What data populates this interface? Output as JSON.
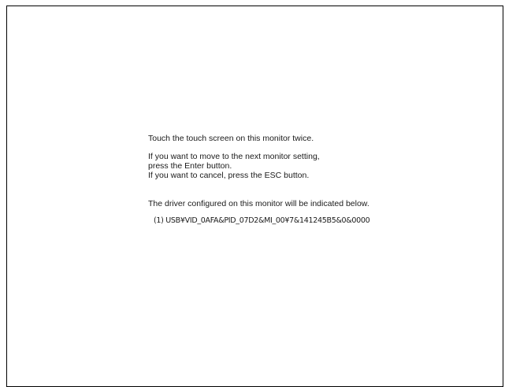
{
  "instructions": {
    "line1": "Touch the touch screen on this monitor twice.",
    "line2": "If you want to move to the next monitor setting,",
    "line3": "press the Enter button.",
    "line4": "If you want to cancel, press the ESC button."
  },
  "driver_section": {
    "heading": "The driver configured on this monitor will be indicated below.",
    "entries": [
      "(1) USB¥VID_0AFA&PID_07D2&MI_00¥7&141245B5&0&0000"
    ]
  }
}
